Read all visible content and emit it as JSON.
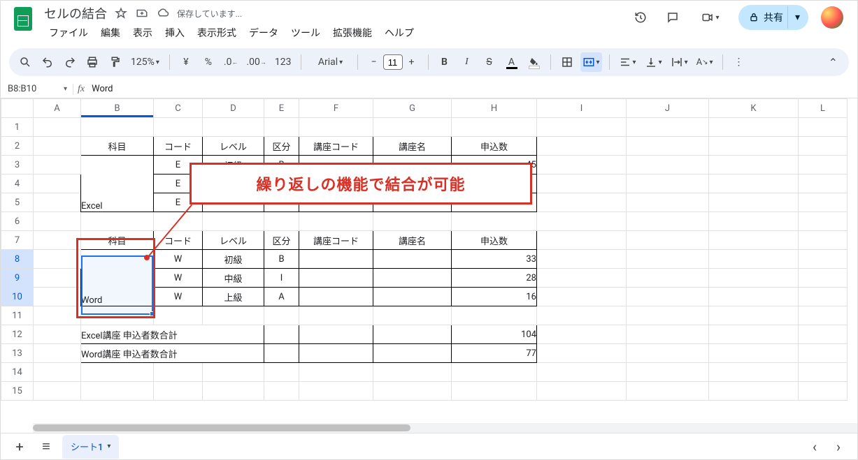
{
  "doc": {
    "title": "セルの結合",
    "save_status": "保存しています...",
    "star_tooltip": "star",
    "move_tooltip": "move",
    "status_tooltip": "see-document-status"
  },
  "menus": [
    "ファイル",
    "編集",
    "表示",
    "挿入",
    "表示形式",
    "データ",
    "ツール",
    "拡張機能",
    "ヘルプ"
  ],
  "share": {
    "label": "共有"
  },
  "toolbar": {
    "zoom": "125%",
    "font_name": "Arial",
    "font_size": "11"
  },
  "namebox": {
    "ref": "B8:B10",
    "formula": "Word"
  },
  "columns": [
    "A",
    "B",
    "C",
    "D",
    "E",
    "F",
    "G",
    "H",
    "I",
    "J",
    "K",
    "L"
  ],
  "rows_shown": 15,
  "selected_rows": [
    8,
    9,
    10
  ],
  "selected_col": "B",
  "sheet_tab": "シート1",
  "annotation": "繰り返しの機能で結合が可能",
  "headers1": {
    "subject": "科目",
    "code": "コード",
    "level": "レベル",
    "kubun": "区分",
    "kcode": "講座コード",
    "kname": "講座名",
    "apply": "申込数"
  },
  "excel_block": {
    "subject": "Excel",
    "rows": [
      {
        "code": "E",
        "level": "初級",
        "kubun": "B",
        "kcode": "",
        "kname": "",
        "apply": 45
      },
      {
        "code": "E",
        "level": "",
        "kubun": "",
        "kcode": "",
        "kname": "",
        "apply": ""
      },
      {
        "code": "E",
        "level": "",
        "kubun": "",
        "kcode": "",
        "kname": "",
        "apply": ""
      }
    ]
  },
  "headers2": {
    "subject": "科目",
    "code": "コード",
    "level": "レベル",
    "kubun": "区分",
    "kcode": "講座コード",
    "kname": "講座名",
    "apply": "申込数"
  },
  "word_block": {
    "subject": "Word",
    "rows": [
      {
        "code": "W",
        "level": "初級",
        "kubun": "B",
        "kcode": "",
        "kname": "",
        "apply": 33
      },
      {
        "code": "W",
        "level": "中級",
        "kubun": "I",
        "kcode": "",
        "kname": "",
        "apply": 28
      },
      {
        "code": "W",
        "level": "上級",
        "kubun": "A",
        "kcode": "",
        "kname": "",
        "apply": 16
      }
    ]
  },
  "totals": [
    {
      "label": "Excel講座 申込者数合計",
      "value": 104
    },
    {
      "label": "Word講座 申込者数合計",
      "value": 77
    }
  ]
}
